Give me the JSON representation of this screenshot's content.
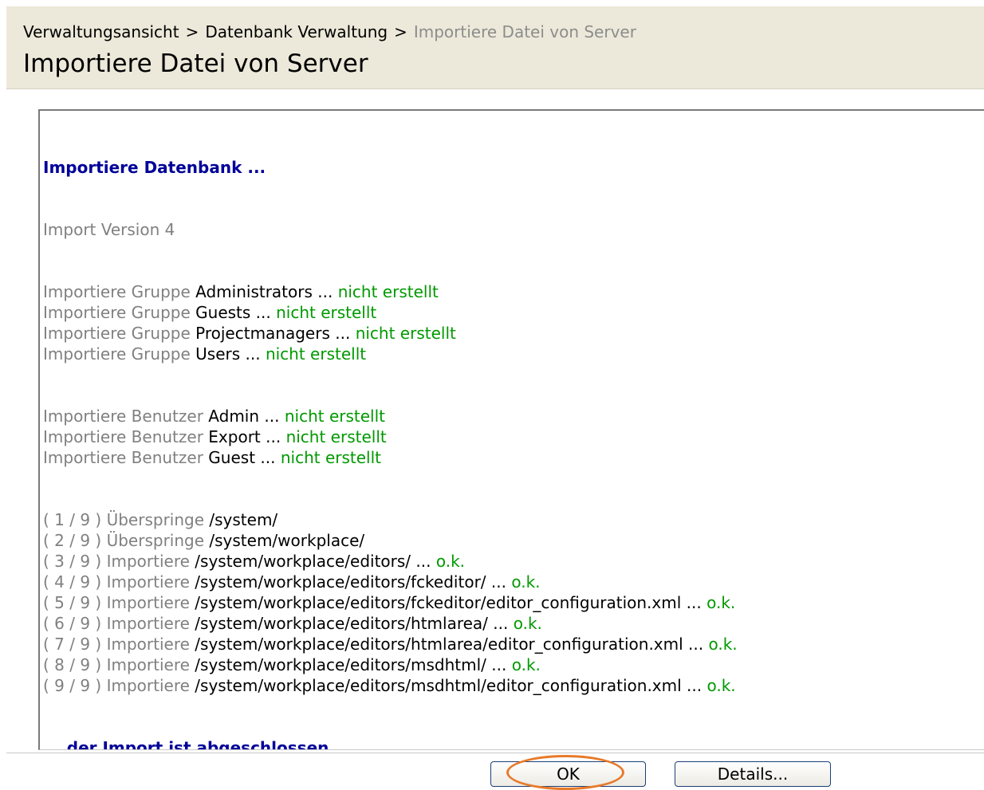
{
  "header": {
    "breadcrumb": [
      {
        "label": "Verwaltungsansicht"
      },
      {
        "label": "Datenbank Verwaltung"
      },
      {
        "label": "Importiere Datei von Server"
      }
    ],
    "separator": ">",
    "title": "Importiere Datei von Server"
  },
  "log": {
    "heading": "Importiere Datenbank ...",
    "version": "Import Version 4",
    "groups": [
      {
        "prefix": "Importiere Gruppe ",
        "name": "Administrators",
        "ellipsis": " ... ",
        "status": "nicht erstellt"
      },
      {
        "prefix": "Importiere Gruppe ",
        "name": "Guests",
        "ellipsis": " ... ",
        "status": "nicht erstellt"
      },
      {
        "prefix": "Importiere Gruppe ",
        "name": "Projectmanagers",
        "ellipsis": " ... ",
        "status": "nicht erstellt"
      },
      {
        "prefix": "Importiere Gruppe ",
        "name": "Users",
        "ellipsis": " ... ",
        "status": "nicht erstellt"
      }
    ],
    "users": [
      {
        "prefix": "Importiere Benutzer ",
        "name": "Admin",
        "ellipsis": " ... ",
        "status": "nicht erstellt"
      },
      {
        "prefix": "Importiere Benutzer ",
        "name": "Export",
        "ellipsis": " ... ",
        "status": "nicht erstellt"
      },
      {
        "prefix": "Importiere Benutzer ",
        "name": "Guest",
        "ellipsis": " ... ",
        "status": "nicht erstellt"
      }
    ],
    "files": [
      {
        "counter": "( 1 / 9 ) ",
        "action": "Überspringe ",
        "path": "/system/",
        "ellipsis": "",
        "status": ""
      },
      {
        "counter": "( 2 / 9 ) ",
        "action": "Überspringe ",
        "path": "/system/workplace/",
        "ellipsis": "",
        "status": ""
      },
      {
        "counter": "( 3 / 9 ) ",
        "action": "Importiere ",
        "path": "/system/workplace/editors/",
        "ellipsis": " ... ",
        "status": "o.k."
      },
      {
        "counter": "( 4 / 9 ) ",
        "action": "Importiere ",
        "path": "/system/workplace/editors/fckeditor/",
        "ellipsis": " ... ",
        "status": "o.k."
      },
      {
        "counter": "( 5 / 9 ) ",
        "action": "Importiere ",
        "path": "/system/workplace/editors/fckeditor/editor_configuration.xml",
        "ellipsis": " ... ",
        "status": "o.k."
      },
      {
        "counter": "( 6 / 9 ) ",
        "action": "Importiere ",
        "path": "/system/workplace/editors/htmlarea/",
        "ellipsis": " ... ",
        "status": "o.k."
      },
      {
        "counter": "( 7 / 9 ) ",
        "action": "Importiere ",
        "path": "/system/workplace/editors/htmlarea/editor_configuration.xml",
        "ellipsis": " ... ",
        "status": "o.k."
      },
      {
        "counter": "( 8 / 9 ) ",
        "action": "Importiere ",
        "path": "/system/workplace/editors/msdhtml/",
        "ellipsis": " ... ",
        "status": "o.k."
      },
      {
        "counter": "( 9 / 9 ) ",
        "action": "Importiere ",
        "path": "/system/workplace/editors/msdhtml/editor_configuration.xml",
        "ellipsis": " ... ",
        "status": "o.k."
      }
    ],
    "footer": "... der Import ist abgeschlossen"
  },
  "buttons": {
    "ok_label": "OK",
    "details_label": "Details..."
  },
  "colors": {
    "header_bg": "#ECE9DA",
    "heading_blue": "#000099",
    "status_green": "#009900",
    "muted_gray": "#808080",
    "highlight_orange": "#e87a2a"
  }
}
